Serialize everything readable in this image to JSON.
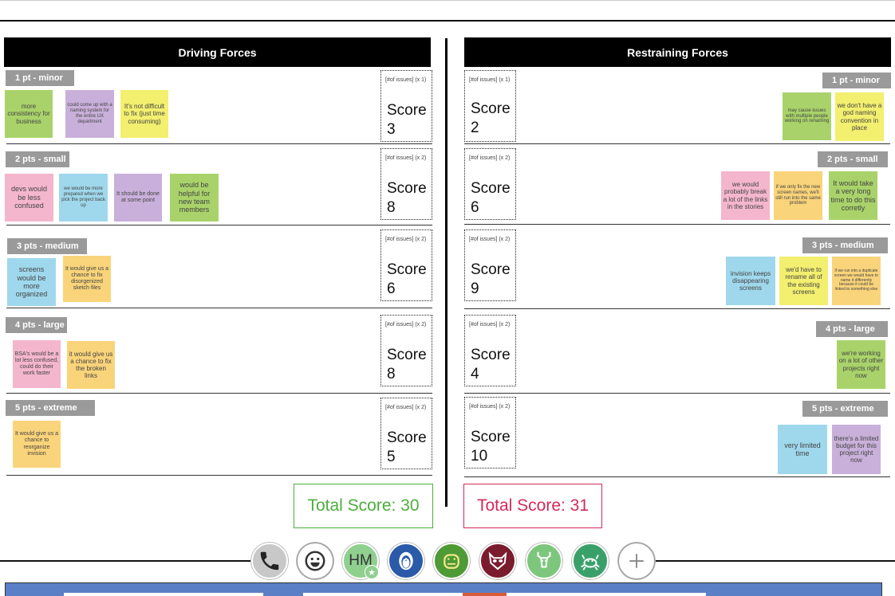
{
  "driving": {
    "title": "Driving Forces",
    "total": "Total Score: 30",
    "rows": [
      {
        "tag": "1 pt - minor",
        "mult": "[#of issues] (x 1)",
        "score_label": "Score",
        "score": "3",
        "notes": [
          "more consistency for business",
          "could come up with a naming system for the entire UX department",
          "It's not difficult to fix (just time consuming)"
        ]
      },
      {
        "tag": "2 pts - small",
        "mult": "[#of issues] (x 2)",
        "score_label": "Score",
        "score": "8",
        "notes": [
          "devs would be less confused",
          "we would be more prepared when we pick the project back up",
          "It should be done at some point",
          "would be helpful for new team members"
        ]
      },
      {
        "tag": "3 pts - medium",
        "mult": "[#of issues] (x 2)",
        "score_label": "Score",
        "score": "6",
        "notes": [
          "screens would be more organized",
          "It would give us a chance to fix disorgenized sketch files"
        ]
      },
      {
        "tag": "4 pts - large",
        "mult": "[#of issues] (x 2)",
        "score_label": "Score",
        "score": "8",
        "notes": [
          "BSA's would be a lot less confused, could do their work faster",
          "it would give us a chance to fix the broken links"
        ]
      },
      {
        "tag": "5 pts - extreme",
        "mult": "[#of issues] (x 2)",
        "score_label": "Score",
        "score": "5",
        "notes": [
          "It would give us a chance to reorganize invision"
        ]
      }
    ]
  },
  "restraining": {
    "title": "Restraining Forces",
    "total": "Total Score: 31",
    "rows": [
      {
        "tag": "1 pt - minor",
        "mult": "[#of issues] (x 1)",
        "score_label": "Score",
        "score": "2",
        "notes": [
          "may cause issues with multiple people working on renaming",
          "we don't have a god naming convention in place"
        ]
      },
      {
        "tag": "2 pts - small",
        "mult": "[#of issues] (x 2)",
        "score_label": "Score",
        "score": "6",
        "notes": [
          "we would probably break a lot of the links in the stories",
          "if we only fix the new screen names, we'll still run into the same problem",
          "It would take a very long time to do this corretly"
        ]
      },
      {
        "tag": "3 pts - medium",
        "mult": "[#of issues] (x 2)",
        "score_label": "Score",
        "score": "9",
        "notes": [
          "invision keeps disappearing screens",
          "we'd have to rename all of the existing screens",
          "If we run into a duplicate screen we would have to name it differently because it could be linked to something else"
        ]
      },
      {
        "tag": "4 pts - large",
        "mult": "[#of issues] (x 2)",
        "score_label": "Score",
        "score": "4",
        "notes": [
          "we're working on a lot of other projects right now"
        ]
      },
      {
        "tag": "5 pts - extreme",
        "mult": "[#of issues] (x 2)",
        "score_label": "Score",
        "score": "10",
        "notes": [
          "very limited time",
          "there's a limited budget for this project right now"
        ]
      }
    ]
  },
  "participants": {
    "initials": "HM",
    "avatars": [
      "phone-icon",
      "emoji-icon",
      "user-hm",
      "penguin-icon",
      "hippo-icon",
      "raccoon-icon",
      "deer-icon",
      "crab-icon",
      "add-icon"
    ]
  },
  "colors": {
    "driving_total": "#4cae3c",
    "restraining_total": "#d22a5a",
    "header": "#000000",
    "tag": "#9a9a9a"
  }
}
